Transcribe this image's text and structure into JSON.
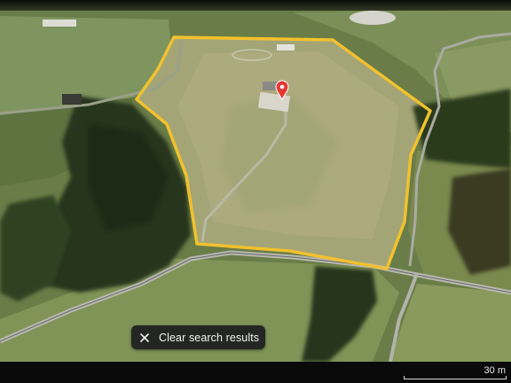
{
  "map": {
    "view": "satellite-3d",
    "pin_color": "#e53935",
    "boundary_color": "#f2c12e"
  },
  "search": {
    "clear_label": "Clear search results",
    "clear_icon": "close-icon"
  },
  "scale": {
    "label": "30 m"
  }
}
